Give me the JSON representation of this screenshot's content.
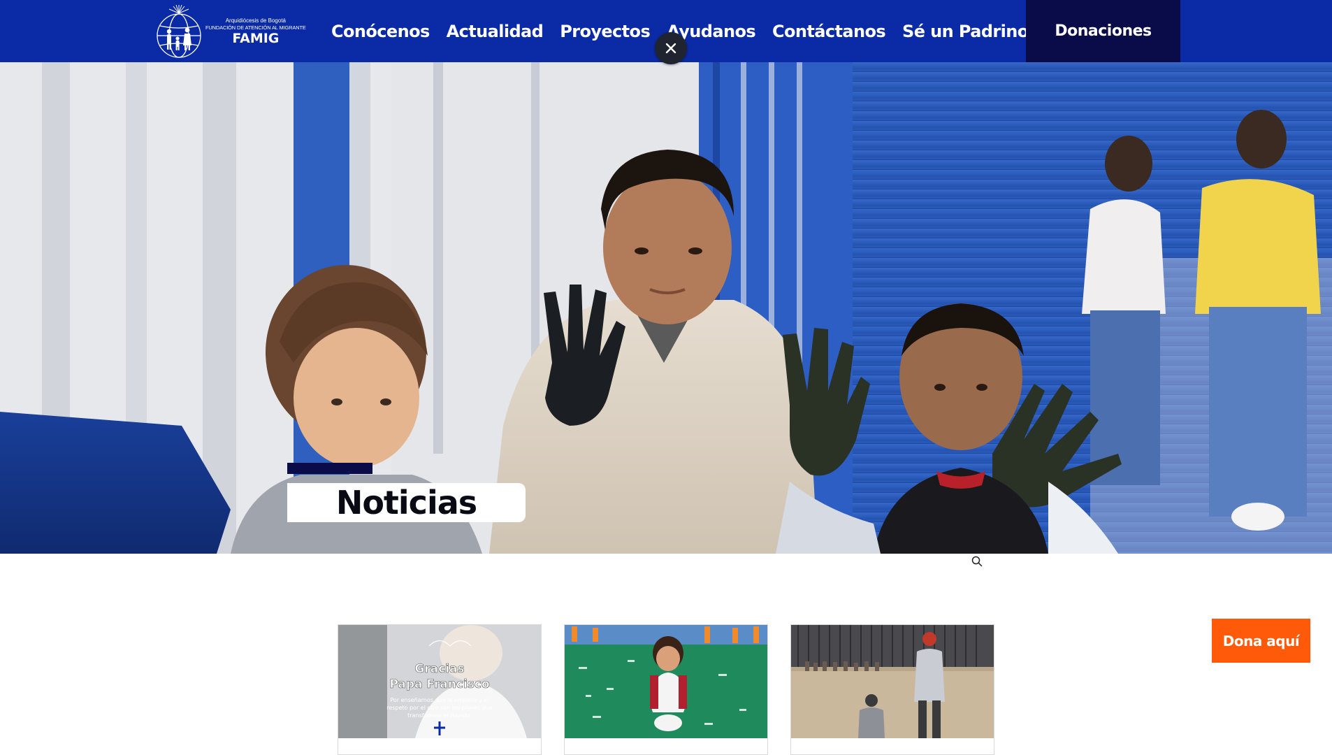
{
  "header": {
    "logo": {
      "line1": "Arquidiócesis de Bogotá",
      "line2": "FUNDACIÓN DE ATENCIÓN AL MIGRANTE",
      "name": "FAMIG"
    },
    "nav": [
      {
        "label": "Conócenos"
      },
      {
        "label": "Actualidad"
      },
      {
        "label": "Proyectos"
      },
      {
        "label": "Ayudanos"
      },
      {
        "label": "Contáctanos"
      },
      {
        "label": "Sé un Padrino(a)"
      }
    ],
    "donate_label": "Donaciones"
  },
  "hero": {
    "title": "Noticias"
  },
  "cards": [
    {
      "thumb_title_1": "Gracias",
      "thumb_title_2": "Papa Francisco",
      "thumb_caption_1": "Por enseñarnos que la empatía y el",
      "thumb_caption_2": "respeto por el otro son los pilares que",
      "thumb_caption_3": "transforman el mundo."
    },
    {},
    {}
  ],
  "floating": {
    "dona_label": "Dona aquí"
  },
  "colors": {
    "header_bg": "#0a2aa6",
    "donate_bg": "#0a0c4a",
    "accent_orange": "#ff5a0a"
  },
  "icons": [
    "close-icon",
    "search-icon",
    "famig-logo-icon"
  ]
}
